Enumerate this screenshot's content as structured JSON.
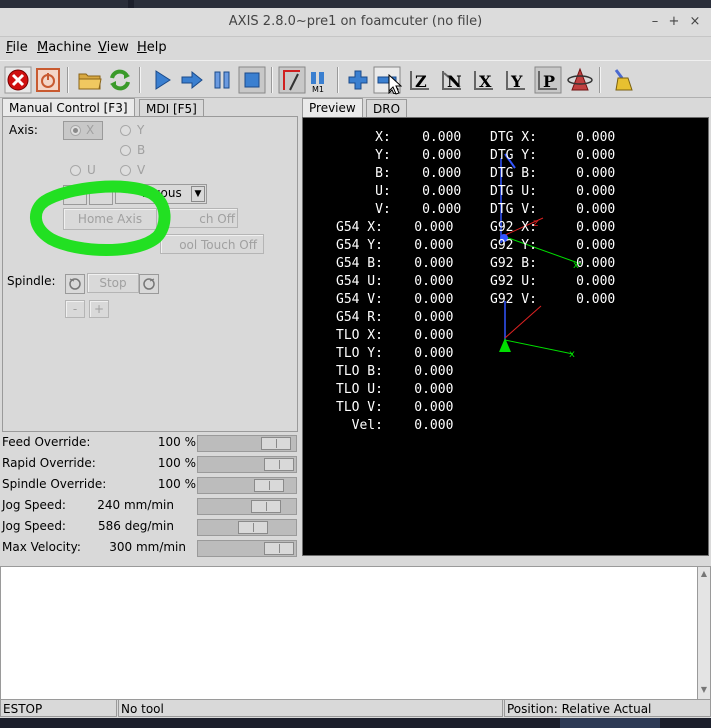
{
  "window": {
    "title": "AXIS 2.8.0~pre1 on foamcuter (no file)",
    "controls": {
      "minimize": "–",
      "maximize": "+",
      "close": "×"
    }
  },
  "menu": [
    "File",
    "Machine",
    "View",
    "Help"
  ],
  "toolbar_icons": [
    "estop-icon",
    "machine-power-icon",
    "open-file-icon",
    "reload-icon",
    "run-icon",
    "step-icon",
    "pause-icon",
    "stop-icon",
    "block-delete-icon",
    "optional-stop-icon",
    "zoom-in-icon",
    "zoom-out-icon",
    "view-z-icon",
    "view-z2-icon",
    "view-x-icon",
    "view-y-icon",
    "view-p-icon",
    "rotate-view-icon",
    "clear-plot-icon"
  ],
  "tabs_left": {
    "manual": "Manual Control [F3]",
    "mdi": "MDI [F5]"
  },
  "manual": {
    "axis_label": "Axis:",
    "axes": [
      "X",
      "Y",
      "B",
      "U",
      "V"
    ],
    "selected_axis": "X",
    "jog_mode": "Continuous",
    "jog_mode_visible": "inuous",
    "home_button": "Home Axis",
    "touch_off_button": "Touch Off",
    "tool_touch_off_button": "Tool Touch Off",
    "touch_off_visible": "ch Off",
    "tool_touch_off_visible": "ool Touch Off",
    "spindle_label": "Spindle:",
    "spindle_stop": "Stop",
    "spindle_minus": "-",
    "spindle_plus": "+"
  },
  "overrides": [
    {
      "label": "Feed Override:",
      "value": "100 %",
      "level": 0.95
    },
    {
      "label": "Rapid Override:",
      "value": "100 %",
      "level": 1.0
    },
    {
      "label": "Spindle Override:",
      "value": "100 %",
      "level": 0.85
    },
    {
      "label": "Jog Speed:",
      "value": "240 mm/min",
      "level": 0.8
    },
    {
      "label": "Jog Speed:",
      "value": "586 deg/min",
      "level": 0.6
    },
    {
      "label": "Max Velocity:",
      "value": "300 mm/min",
      "level": 1.0
    }
  ],
  "tabs_right": {
    "preview": "Preview",
    "dro": "DRO"
  },
  "dro_left": [
    "     X:    0.000",
    "     Y:    0.000",
    "     B:    0.000",
    "     U:    0.000",
    "     V:    0.000",
    "G54 X:    0.000",
    "G54 Y:    0.000",
    "G54 B:    0.000",
    "G54 U:    0.000",
    "G54 V:    0.000",
    "G54 R:    0.000",
    "TLO X:    0.000",
    "TLO Y:    0.000",
    "TLO B:    0.000",
    "TLO U:    0.000",
    "TLO V:    0.000",
    "  Vel:    0.000"
  ],
  "dro_right": [
    "DTG X:     0.000",
    "DTG Y:     0.000",
    "DTG B:     0.000",
    "DTG U:     0.000",
    "DTG V:     0.000",
    "G92 X:     0.000",
    "G92 Y:     0.000",
    "G92 B:     0.000",
    "G92 U:     0.000",
    "G92 V:     0.000"
  ],
  "status": {
    "estop": "ESTOP",
    "tool": "No tool",
    "position": "Position: Relative Actual"
  },
  "colors": {
    "highlight": "#22e022",
    "preview_bg": "#000000",
    "axis_green": "#00dd00",
    "axis_red": "#dd2222",
    "axis_blue": "#3355ff"
  }
}
